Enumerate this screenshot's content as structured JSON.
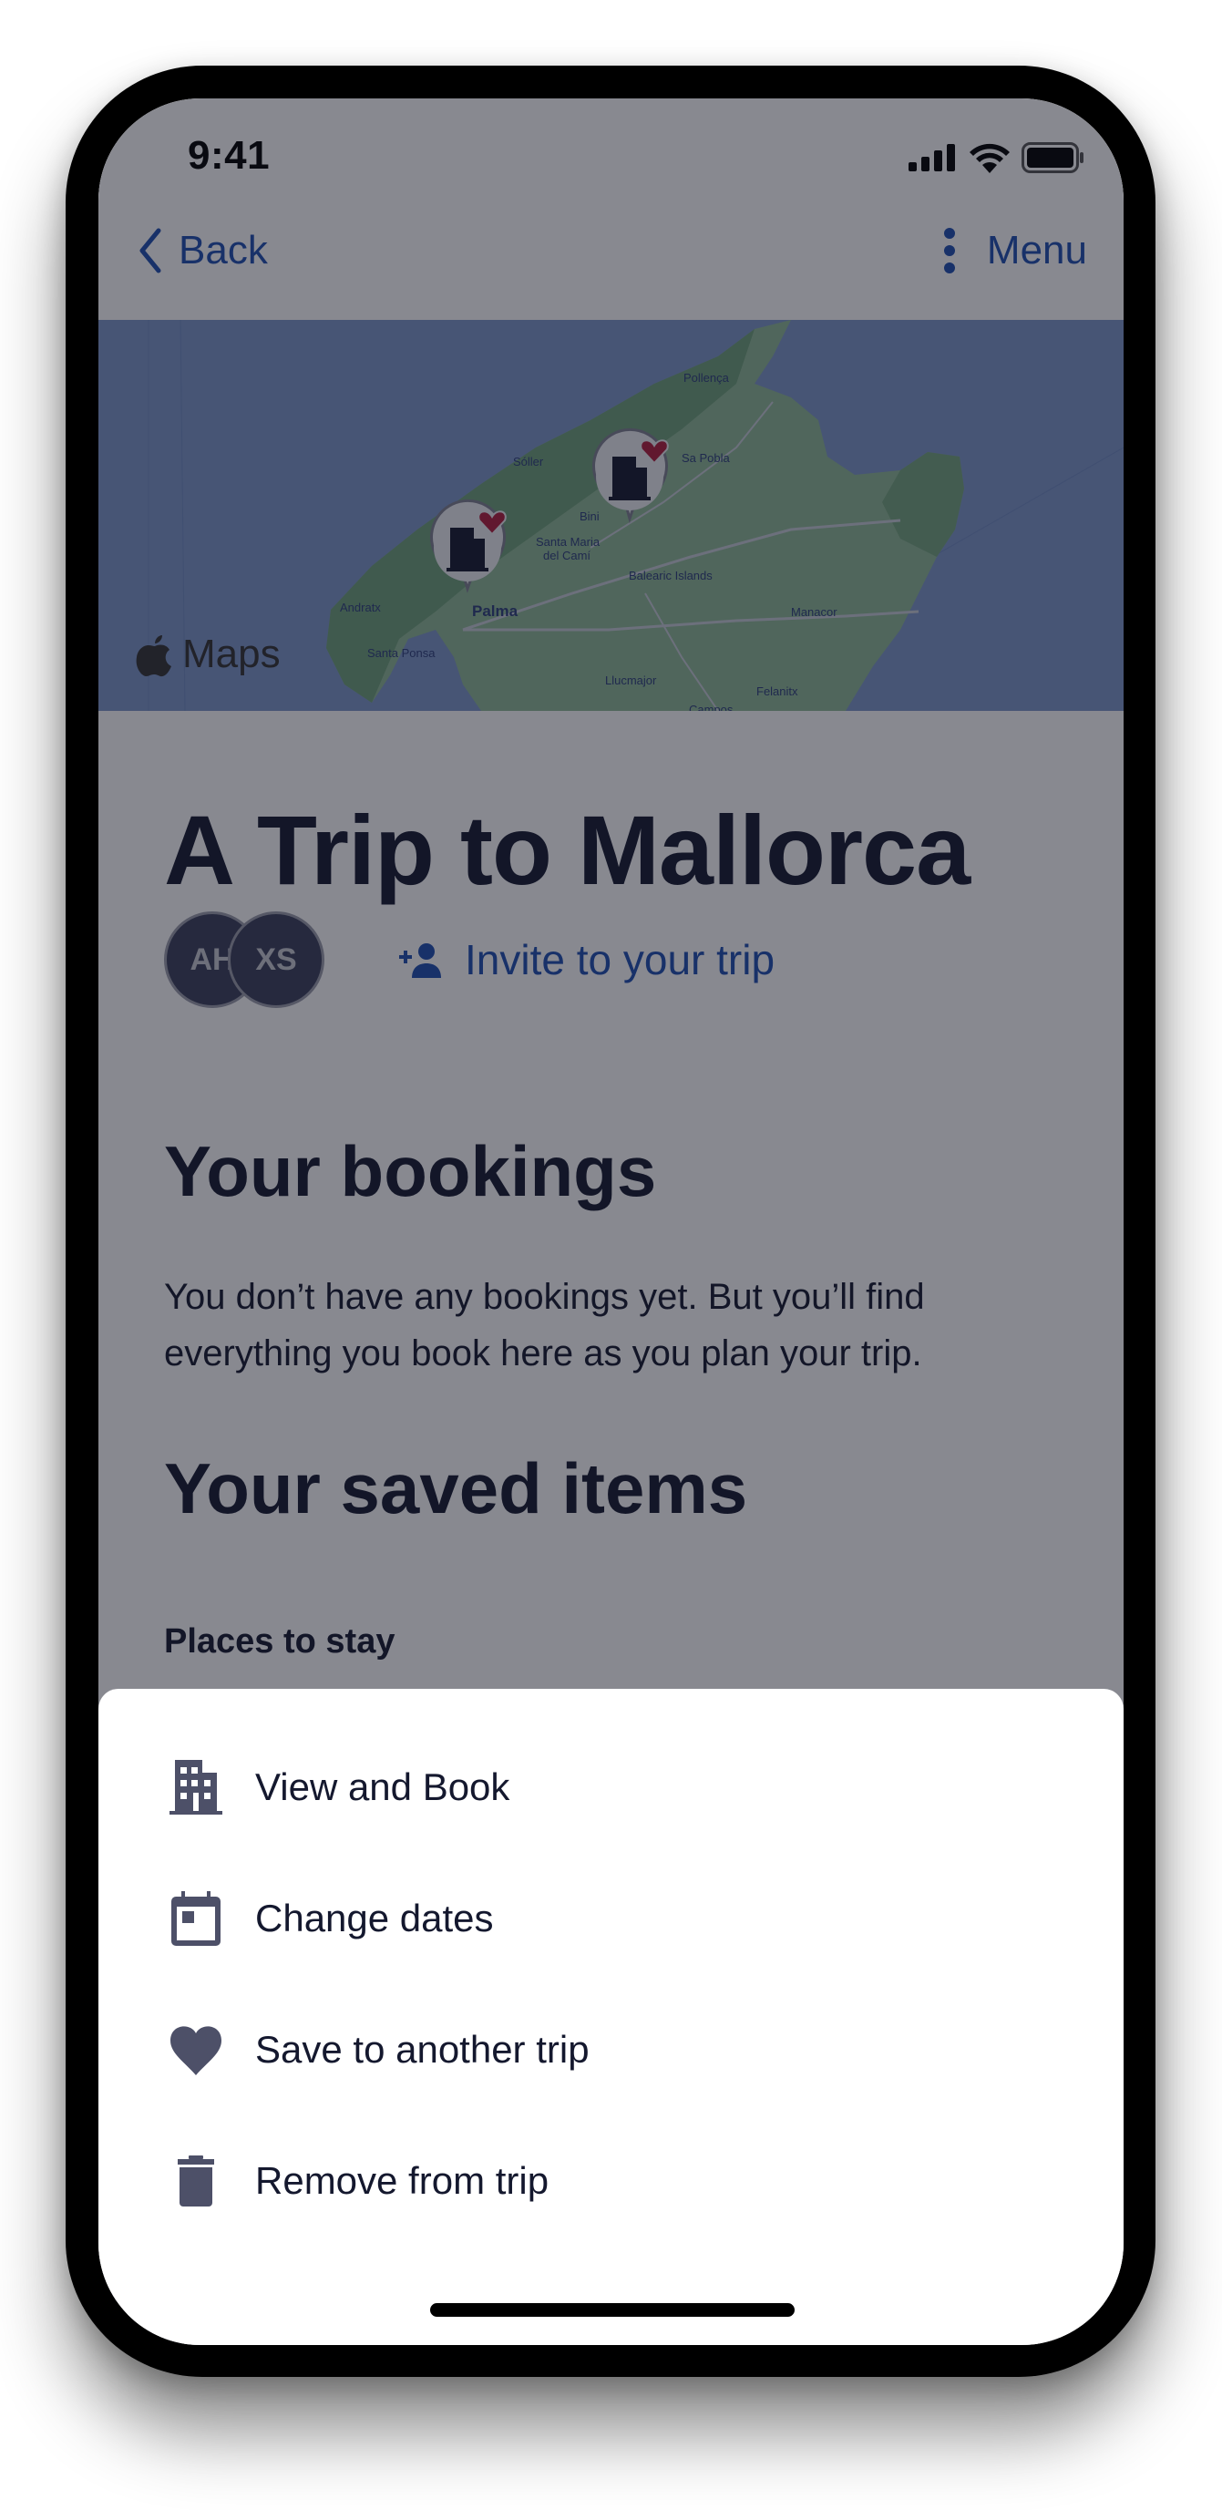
{
  "status_bar": {
    "time": "9:41",
    "icons": [
      "cellular-signal-icon",
      "wifi-icon",
      "battery-icon"
    ]
  },
  "nav": {
    "back_label": "Back",
    "menu_label": "Menu",
    "accent_color": "#1e4fb0"
  },
  "map": {
    "provider_label": "Maps",
    "place_labels": [
      "Pollença",
      "Sóller",
      "Sa Pobla",
      "Bini",
      "Santa Maria",
      "del Camí",
      "Balearic Islands",
      "Andratx",
      "Palma",
      "Manacor",
      "Santa Ponsa",
      "Llucmajor",
      "Felanitx",
      "Campos"
    ],
    "pins": [
      {
        "name": "hotel-pin-palma",
        "icon": "building-icon",
        "saved": true
      },
      {
        "name": "hotel-pin-binissalem",
        "icon": "building-icon",
        "saved": true
      }
    ]
  },
  "trip": {
    "title": "A Trip to Mallorca",
    "members": [
      {
        "initials": "AH"
      },
      {
        "initials": "XS"
      }
    ],
    "invite_label": "Invite to your trip"
  },
  "bookings": {
    "heading": "Your bookings",
    "empty_text": "You don’t have any bookings yet. But you’ll find everything you book here as you plan your trip."
  },
  "saved": {
    "heading": "Your saved items",
    "subheading": "Places to stay"
  },
  "action_sheet": {
    "items": [
      {
        "label": "View and Book",
        "icon": "building-icon"
      },
      {
        "label": "Change dates",
        "icon": "calendar-icon"
      },
      {
        "label": "Save to another trip",
        "icon": "heart-icon"
      },
      {
        "label": "Remove from trip",
        "icon": "trash-icon"
      }
    ]
  },
  "colors": {
    "text_primary": "#14182e",
    "icon_muted": "#4d5068",
    "saved_heart": "#b01c3c"
  }
}
